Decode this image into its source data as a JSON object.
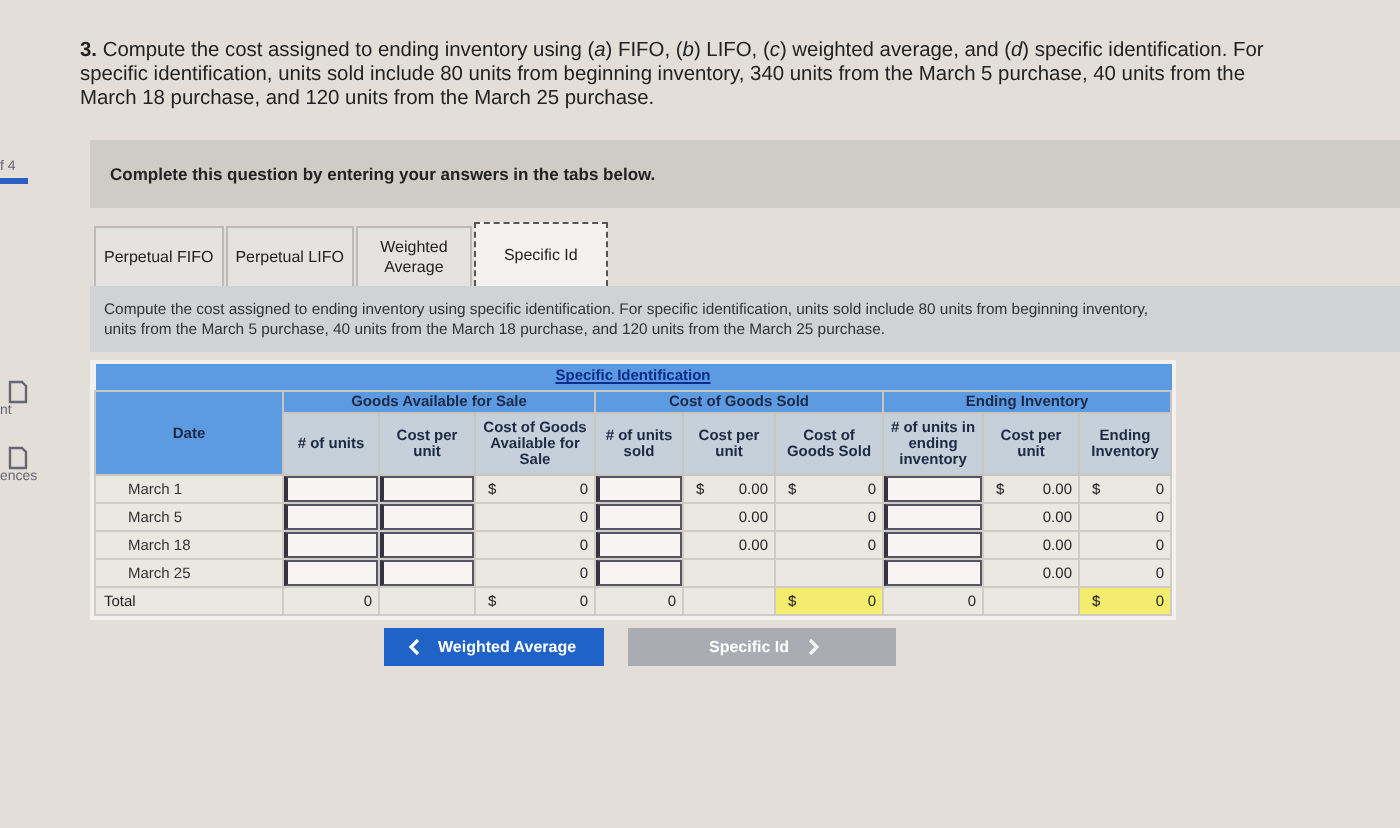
{
  "sidebar": {
    "items": [
      {
        "kind": "progress",
        "label": "f 4",
        "selected": true
      },
      {
        "kind": "link",
        "label": "nt",
        "selected": false
      },
      {
        "kind": "link",
        "label": "ences",
        "selected": false
      }
    ]
  },
  "question": {
    "number": "3.",
    "text": "Compute the cost assigned to ending inventory using (*a*) FIFO, (*b*) LIFO, (*c*) weighted average, and (*d*) specific identification. For specific identification, units sold include 80 units from beginning inventory, 340 units from the March 5 purchase, 40 units from the March 18 purchase, and 120 units from the March 25 purchase."
  },
  "instruction": "Complete this question by entering your answers in the tabs below.",
  "tabs": [
    {
      "label": "Perpetual FIFO",
      "selected": false
    },
    {
      "label": "Perpetual LIFO",
      "selected": false
    },
    {
      "label": "Weighted Average",
      "selected": false
    },
    {
      "label": "Specific Id",
      "selected": true
    }
  ],
  "description": [
    "Compute the cost assigned to ending inventory using specific identification. For specific identification, units sold include 80 units from beginning inventory,",
    "units from the March 5 purchase, 40 units from the March 18 purchase, and 120 units from the March 25 purchase."
  ],
  "table": {
    "title": "Specific Identification",
    "date_header": "Date",
    "groups": [
      "Goods Available for Sale",
      "Cost of Goods Sold",
      "Ending Inventory"
    ],
    "columns": [
      "# of units",
      "Cost per unit",
      "Cost of Goods Available for Sale",
      "# of units sold",
      "Cost per unit",
      "Cost of Goods Sold",
      "# of units in ending inventory",
      "Cost per unit",
      "Ending Inventory"
    ],
    "rows": [
      {
        "date": "March 1",
        "cells": [
          {
            "kind": "input"
          },
          {
            "kind": "input"
          },
          {
            "kind": "amount",
            "prefix": "$",
            "value": "0",
            "highlighted": false
          },
          {
            "kind": "input"
          },
          {
            "kind": "amount",
            "prefix": "$",
            "value": "0.00",
            "highlighted": false
          },
          {
            "kind": "amount",
            "prefix": "$",
            "value": "0",
            "highlighted": false
          },
          {
            "kind": "input"
          },
          {
            "kind": "amount",
            "prefix": "$",
            "value": "0.00",
            "highlighted": false
          },
          {
            "kind": "amount",
            "prefix": "$",
            "value": "0",
            "highlighted": false
          }
        ]
      },
      {
        "date": "March 5",
        "cells": [
          {
            "kind": "input"
          },
          {
            "kind": "input"
          },
          {
            "kind": "amount",
            "value": "0",
            "highlighted": false
          },
          {
            "kind": "input"
          },
          {
            "kind": "amount",
            "value": "0.00",
            "highlighted": false
          },
          {
            "kind": "amount",
            "value": "0",
            "highlighted": false
          },
          {
            "kind": "input"
          },
          {
            "kind": "amount",
            "value": "0.00",
            "highlighted": false
          },
          {
            "kind": "amount",
            "value": "0",
            "highlighted": false
          }
        ]
      },
      {
        "date": "March 18",
        "cells": [
          {
            "kind": "input"
          },
          {
            "kind": "input"
          },
          {
            "kind": "amount",
            "value": "0",
            "highlighted": false
          },
          {
            "kind": "input"
          },
          {
            "kind": "amount",
            "value": "0.00",
            "highlighted": false
          },
          {
            "kind": "amount",
            "value": "0",
            "highlighted": false
          },
          {
            "kind": "input"
          },
          {
            "kind": "amount",
            "value": "0.00",
            "highlighted": false
          },
          {
            "kind": "amount",
            "value": "0",
            "highlighted": false
          }
        ]
      },
      {
        "date": "March 25",
        "cells": [
          {
            "kind": "input"
          },
          {
            "kind": "input"
          },
          {
            "kind": "amount",
            "value": "0",
            "highlighted": false
          },
          {
            "kind": "input"
          },
          {
            "kind": "empty"
          },
          {
            "kind": "empty"
          },
          {
            "kind": "input"
          },
          {
            "kind": "amount",
            "value": "0.00",
            "highlighted": false
          },
          {
            "kind": "amount",
            "value": "0",
            "highlighted": false
          }
        ]
      },
      {
        "date": "Total",
        "cells": [
          {
            "kind": "amount",
            "value": "0",
            "highlighted": false
          },
          {
            "kind": "empty"
          },
          {
            "kind": "amount",
            "prefix": "$",
            "value": "0",
            "highlighted": false
          },
          {
            "kind": "amount",
            "value": "0",
            "highlighted": false
          },
          {
            "kind": "empty"
          },
          {
            "kind": "amount",
            "prefix": "$",
            "value": "0",
            "highlighted": true
          },
          {
            "kind": "amount",
            "value": "0",
            "highlighted": false
          },
          {
            "kind": "empty"
          },
          {
            "kind": "amount",
            "prefix": "$",
            "value": "0",
            "highlighted": true
          }
        ]
      }
    ]
  },
  "buttons": [
    {
      "kind": "previous",
      "label": "Weighted Average",
      "disabled": false
    },
    {
      "kind": "next",
      "label": "Specific Id",
      "disabled": true
    }
  ]
}
